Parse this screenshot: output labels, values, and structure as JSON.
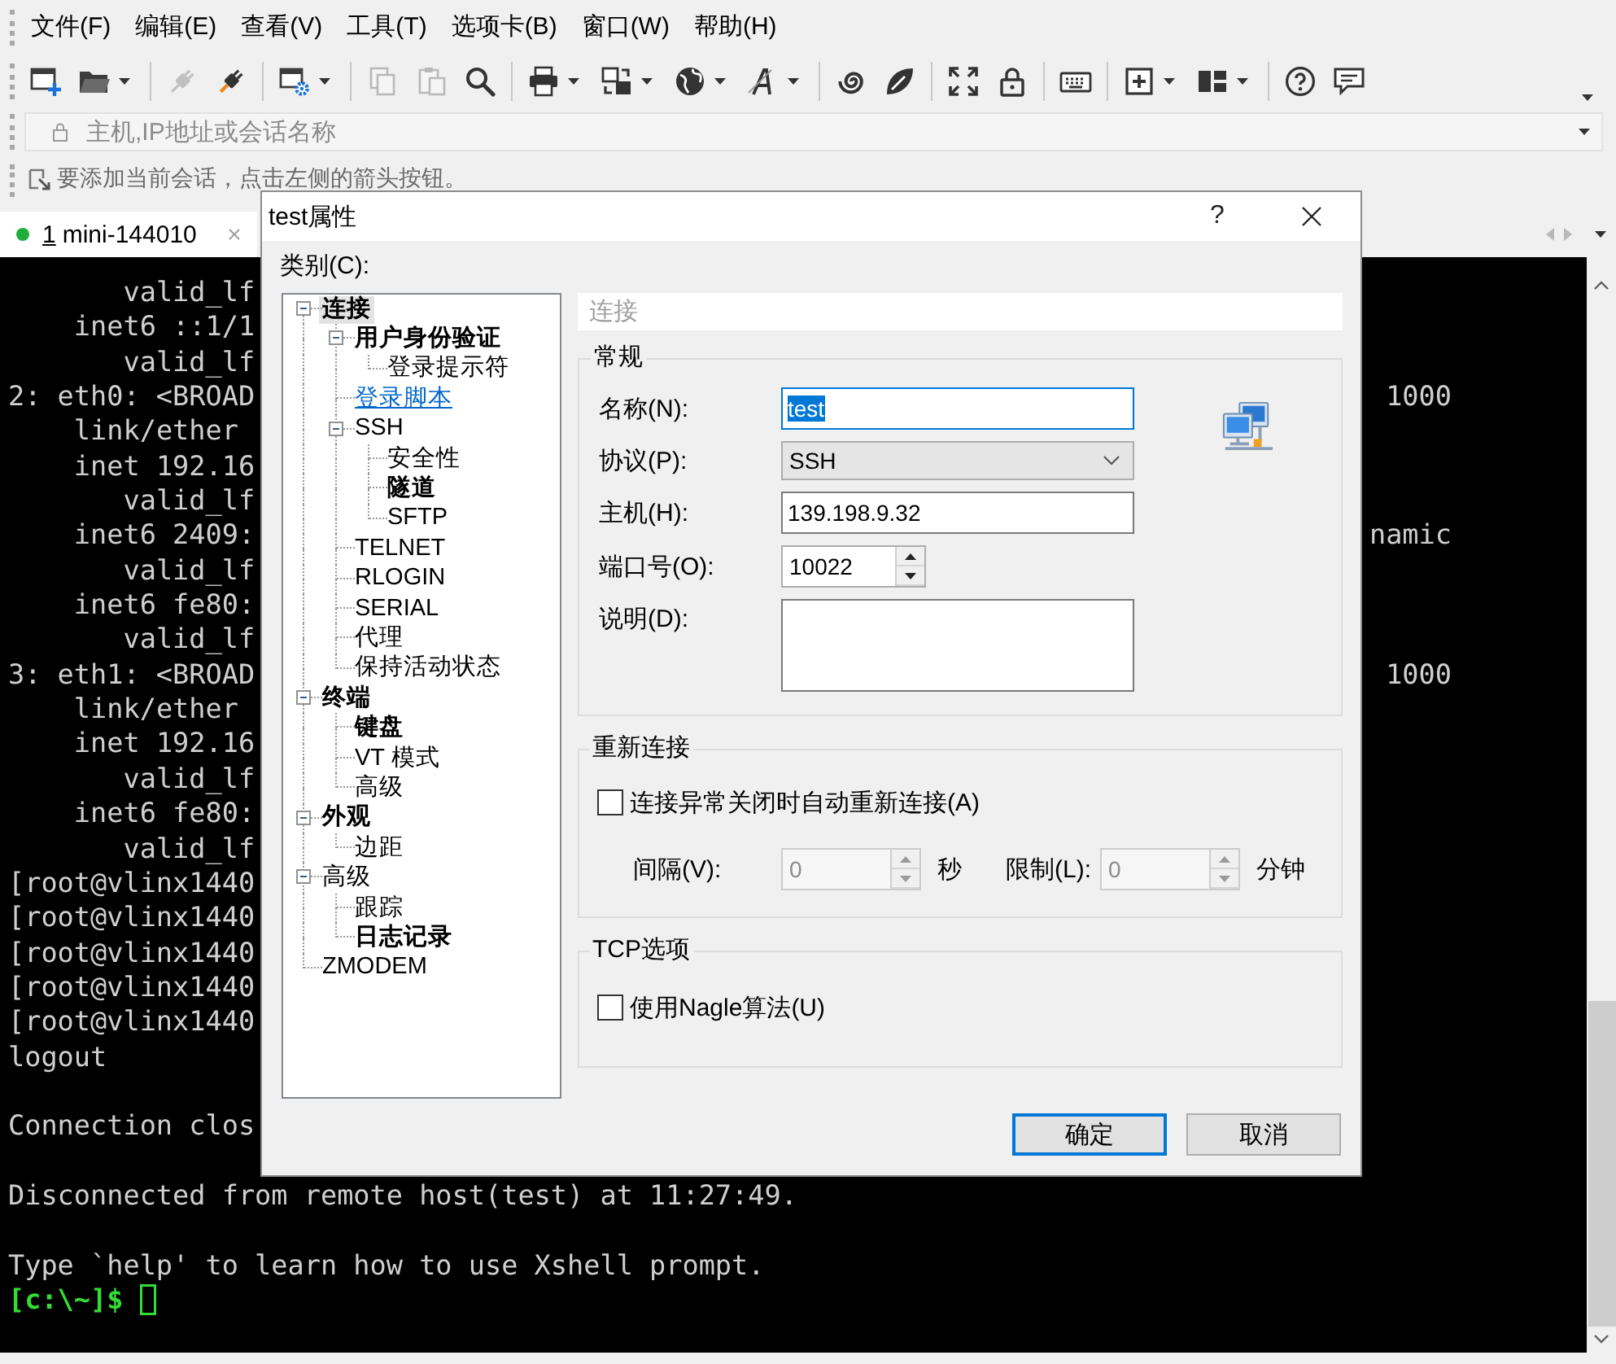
{
  "menu_bar": {
    "items": [
      "文件(F)",
      "编辑(E)",
      "查看(V)",
      "工具(T)",
      "选项卡(B)",
      "窗口(W)",
      "帮助(H)"
    ]
  },
  "toolbar": {
    "groups": [
      [
        {
          "disabled": false,
          "dropdown": false
        },
        {
          "disabled": false,
          "dropdown": true
        }
      ],
      [
        {
          "disabled": true,
          "dropdown": false
        },
        {
          "disabled": false,
          "dropdown": false
        }
      ],
      [
        {
          "disabled": false,
          "dropdown": true
        }
      ],
      [
        {
          "disabled": true,
          "dropdown": false
        },
        {
          "disabled": true,
          "dropdown": false
        },
        {
          "disabled": false,
          "dropdown": false
        }
      ],
      [
        {
          "disabled": false,
          "dropdown": true
        },
        {
          "disabled": false,
          "dropdown": true
        },
        {
          "disabled": false,
          "dropdown": true
        },
        {
          "disabled": false,
          "dropdown": true
        }
      ],
      [
        {
          "disabled": false,
          "dropdown": false
        },
        {
          "disabled": false,
          "dropdown": false
        }
      ],
      [
        {
          "disabled": false,
          "dropdown": false
        },
        {
          "disabled": false,
          "dropdown": false
        }
      ],
      [
        {
          "disabled": false,
          "dropdown": false
        }
      ],
      [
        {
          "disabled": false,
          "dropdown": true
        },
        {
          "disabled": false,
          "dropdown": true
        }
      ],
      [
        {
          "disabled": false,
          "dropdown": false
        },
        {
          "disabled": false,
          "dropdown": false
        }
      ]
    ]
  },
  "address_bar": {
    "placeholder": "主机,IP地址或会话名称"
  },
  "hint_bar": {
    "text": "要添加当前会话，点击左侧的箭头按钮。"
  },
  "tabs": [
    {
      "number": "1",
      "label": "mini-144010",
      "selected": true,
      "connected": true
    }
  ],
  "terminal": {
    "lines": [
      {
        "kind": "output",
        "text": "       valid_lf"
      },
      {
        "kind": "output",
        "text": "    inet6 ::1/1"
      },
      {
        "kind": "output",
        "text": "       valid_lf"
      },
      {
        "kind": "output",
        "text": "2: eth0: <BROAD",
        "tail": "1000"
      },
      {
        "kind": "output",
        "text": "    link/ether"
      },
      {
        "kind": "output",
        "text": "    inet 192.16"
      },
      {
        "kind": "output",
        "text": "       valid_lf"
      },
      {
        "kind": "output",
        "text": "    inet6 2409:",
        "tail": "namic"
      },
      {
        "kind": "output",
        "text": "       valid_lf"
      },
      {
        "kind": "output",
        "text": "    inet6 fe80:"
      },
      {
        "kind": "output",
        "text": "       valid_lf"
      },
      {
        "kind": "output",
        "text": "3: eth1: <BROAD",
        "tail": "1000"
      },
      {
        "kind": "output",
        "text": "    link/ether"
      },
      {
        "kind": "output",
        "text": "    inet 192.16"
      },
      {
        "kind": "output",
        "text": "       valid_lf"
      },
      {
        "kind": "output",
        "text": "    inet6 fe80:"
      },
      {
        "kind": "output",
        "text": "       valid_lf"
      },
      {
        "kind": "output",
        "text": "[root@vlinx1440"
      },
      {
        "kind": "output",
        "text": "[root@vlinx1440"
      },
      {
        "kind": "output",
        "text": "[root@vlinx1440"
      },
      {
        "kind": "output",
        "text": "[root@vlinx1440"
      },
      {
        "kind": "output",
        "text": "[root@vlinx1440"
      },
      {
        "kind": "output",
        "text": "logout"
      },
      {
        "kind": "blank"
      },
      {
        "kind": "output",
        "text": "Connection clos"
      },
      {
        "kind": "blank"
      },
      {
        "kind": "output",
        "text": "Disconnected from remote host(test) at 11:27:49."
      },
      {
        "kind": "blank"
      },
      {
        "kind": "output",
        "text": "Type `help' to learn how to use Xshell prompt."
      },
      {
        "kind": "prompt",
        "text": "[c:\\~]$"
      }
    ]
  },
  "dialog": {
    "title": "test属性",
    "help": "?",
    "category_label": "类别(C):",
    "tree": [
      {
        "label": "连接",
        "bold": true,
        "selected": true,
        "hovered": false,
        "expanded": true,
        "children": [
          {
            "label": "用户身份验证",
            "bold": true,
            "selected": false,
            "hovered": false,
            "expanded": true,
            "children": [
              {
                "label": "登录提示符",
                "bold": false,
                "selected": false,
                "hovered": false
              }
            ]
          },
          {
            "label": "登录脚本",
            "bold": false,
            "selected": false,
            "hovered": true
          },
          {
            "label": "SSH",
            "bold": false,
            "selected": false,
            "hovered": false,
            "expanded": true,
            "children": [
              {
                "label": "安全性",
                "bold": false,
                "selected": false,
                "hovered": false
              },
              {
                "label": "隧道",
                "bold": true,
                "selected": false,
                "hovered": false
              },
              {
                "label": "SFTP",
                "bold": false,
                "selected": false,
                "hovered": false
              }
            ]
          },
          {
            "label": "TELNET",
            "bold": false,
            "selected": false,
            "hovered": false
          },
          {
            "label": "RLOGIN",
            "bold": false,
            "selected": false,
            "hovered": false
          },
          {
            "label": "SERIAL",
            "bold": false,
            "selected": false,
            "hovered": false
          },
          {
            "label": "代理",
            "bold": false,
            "selected": false,
            "hovered": false
          },
          {
            "label": "保持活动状态",
            "bold": false,
            "selected": false,
            "hovered": false
          }
        ]
      },
      {
        "label": "终端",
        "bold": true,
        "selected": false,
        "hovered": false,
        "expanded": true,
        "children": [
          {
            "label": "键盘",
            "bold": true,
            "selected": false,
            "hovered": false
          },
          {
            "label": "VT 模式",
            "bold": false,
            "selected": false,
            "hovered": false
          },
          {
            "label": "高级",
            "bold": false,
            "selected": false,
            "hovered": false
          }
        ]
      },
      {
        "label": "外观",
        "bold": true,
        "selected": false,
        "hovered": false,
        "expanded": true,
        "children": [
          {
            "label": "边距",
            "bold": false,
            "selected": false,
            "hovered": false
          }
        ]
      },
      {
        "label": "高级",
        "bold": false,
        "selected": false,
        "hovered": false,
        "expanded": true,
        "children": [
          {
            "label": "跟踪",
            "bold": false,
            "selected": false,
            "hovered": false
          },
          {
            "label": "日志记录",
            "bold": true,
            "selected": false,
            "hovered": false
          }
        ]
      },
      {
        "label": "ZMODEM",
        "bold": false,
        "selected": false,
        "hovered": false
      }
    ],
    "panel_title": "连接",
    "general": {
      "legend": "常规",
      "fields": [
        {
          "kind": "text",
          "label": "名称(N):",
          "value": "test",
          "focused": true
        },
        {
          "kind": "select",
          "label": "协议(P):",
          "value": "SSH",
          "focused": false
        },
        {
          "kind": "text",
          "label": "主机(H):",
          "value": "139.198.9.32",
          "focused": false
        },
        {
          "kind": "spin",
          "label": "端口号(O):",
          "value": "10022",
          "focused": false
        },
        {
          "kind": "textarea",
          "label": "说明(D):",
          "focused": false
        }
      ]
    },
    "reconnect": {
      "legend": "重新连接",
      "checkbox": {
        "label": "连接异常关闭时自动重新连接(A)",
        "checked": false
      },
      "spins": [
        {
          "label": "间隔(V):",
          "value": "0",
          "unit": "秒",
          "disabled": true
        },
        {
          "label": "限制(L):",
          "value": "0",
          "unit": "分钟",
          "disabled": true
        }
      ]
    },
    "tcp": {
      "legend": "TCP选项",
      "checkbox": {
        "label": "使用Nagle算法(U)",
        "checked": false
      }
    },
    "buttons": [
      {
        "label": "确定",
        "default": true
      },
      {
        "label": "取消",
        "default": false
      }
    ]
  }
}
